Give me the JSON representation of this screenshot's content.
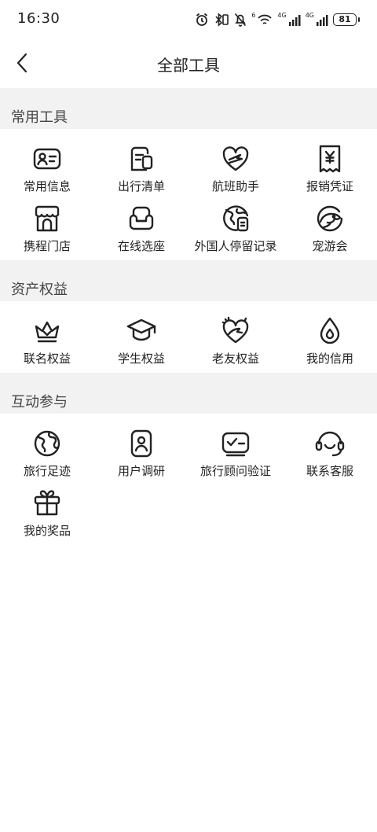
{
  "status_bar": {
    "time": "16:30",
    "battery": "81",
    "signal_label_1": "4G",
    "signal_label_2": "4G",
    "wifi_label": "6"
  },
  "nav": {
    "title": "全部工具"
  },
  "sections": [
    {
      "title": "常用工具",
      "items": [
        {
          "label": "常用信息",
          "icon": "id-card-icon"
        },
        {
          "label": "出行清单",
          "icon": "checklist-icon"
        },
        {
          "label": "航班助手",
          "icon": "heart-plane-icon"
        },
        {
          "label": "报销凭证",
          "icon": "receipt-yen-icon"
        },
        {
          "label": "携程门店",
          "icon": "storefront-icon"
        },
        {
          "label": "在线选座",
          "icon": "seat-icon"
        },
        {
          "label": "外国人停留记录",
          "icon": "globe-document-icon"
        },
        {
          "label": "宠游会",
          "icon": "pet-icon"
        }
      ]
    },
    {
      "title": "资产权益",
      "items": [
        {
          "label": "联名权益",
          "icon": "crown-icon"
        },
        {
          "label": "学生权益",
          "icon": "graduation-cap-icon"
        },
        {
          "label": "老友权益",
          "icon": "heart-hand-icon"
        },
        {
          "label": "我的信用",
          "icon": "water-drop-icon"
        }
      ]
    },
    {
      "title": "互动参与",
      "items": [
        {
          "label": "旅行足迹",
          "icon": "globe-icon"
        },
        {
          "label": "用户调研",
          "icon": "user-document-icon"
        },
        {
          "label": "旅行顾问验证",
          "icon": "verify-card-icon"
        },
        {
          "label": "联系客服",
          "icon": "headset-icon"
        },
        {
          "label": "我的奖品",
          "icon": "gift-icon"
        }
      ]
    }
  ]
}
